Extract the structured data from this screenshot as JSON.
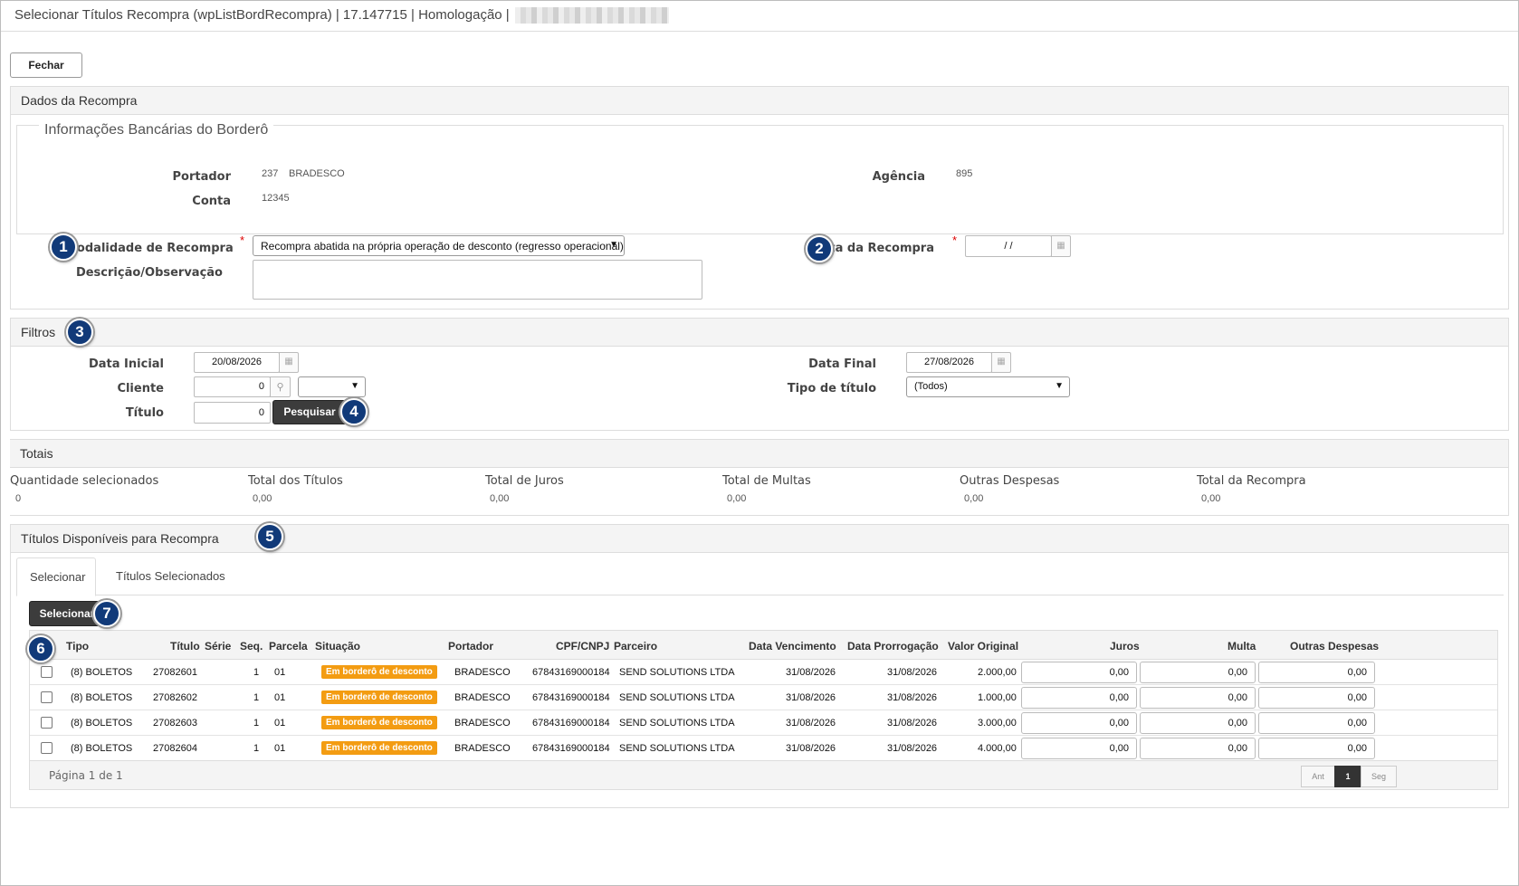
{
  "window": {
    "title": "Selecionar Títulos Recompra (wpListBordRecompra) | 17.147715 | Homologação |"
  },
  "toolbar": {
    "close_label": "Fechar"
  },
  "dados": {
    "header": "Dados da Recompra",
    "legend": "Informações Bancárias do Borderô",
    "portador_label": "Portador",
    "portador_code": "237",
    "portador_name": "BRADESCO",
    "agencia_label": "Agência",
    "agencia_value": "895",
    "conta_label": "Conta",
    "conta_value": "12345",
    "modalidade_label": "Modalidade de Recompra",
    "modalidade_value": "Recompra abatida na própria operação de desconto (regresso operacional)",
    "descricao_label": "Descrição/Observação",
    "descricao_value": "",
    "data_recompra_label": "Data da Recompra",
    "data_recompra_value": "/  /",
    "required_mark": "*"
  },
  "filtros": {
    "header": "Filtros",
    "data_inicial_label": "Data Inicial",
    "data_inicial_value": "20/08/2026",
    "data_final_label": "Data Final",
    "data_final_value": "27/08/2026",
    "cliente_label": "Cliente",
    "cliente_value": "0",
    "tipo_titulo_label": "Tipo de título",
    "tipo_titulo_value": "(Todos)",
    "titulo_label": "Título",
    "titulo_value": "0",
    "search_label": "Pesquisar"
  },
  "totais": {
    "header": "Totais",
    "items": [
      {
        "label": "Quantidade selecionados",
        "value": "0"
      },
      {
        "label": "Total dos Títulos",
        "value": "0,00"
      },
      {
        "label": "Total de Juros",
        "value": "0,00"
      },
      {
        "label": "Total de Multas",
        "value": "0,00"
      },
      {
        "label": "Outras Despesas",
        "value": "0,00"
      },
      {
        "label": "Total da Recompra",
        "value": "0,00"
      }
    ]
  },
  "titulos": {
    "header": "Títulos Disponíveis para Recompra",
    "tabs": [
      {
        "label": "Selecionar"
      },
      {
        "label": "Títulos Selecionados"
      }
    ],
    "select_label": "Selecionar",
    "columns": [
      "Tipo",
      "Título",
      "Série",
      "Seq.",
      "Parcela",
      "Situação",
      "Portador",
      "CPF/CNPJ",
      "Parceiro",
      "Data Vencimento",
      "Data Prorrogação",
      "Valor Original",
      "Juros",
      "Multa",
      "Outras Despesas"
    ],
    "rows": [
      {
        "tipo": "(8) BOLETOS",
        "titulo": "27082601",
        "serie": "",
        "seq": "1",
        "parcela": "01",
        "situacao": "Em borderô de desconto",
        "portador": "BRADESCO",
        "cnpj": "67843169000184",
        "parceiro": "SEND SOLUTIONS LTDA",
        "venc": "31/08/2026",
        "prorrog": "31/08/2026",
        "valor": "2.000,00",
        "juros": "0,00",
        "multa": "0,00",
        "outras": "0,00"
      },
      {
        "tipo": "(8) BOLETOS",
        "titulo": "27082602",
        "serie": "",
        "seq": "1",
        "parcela": "01",
        "situacao": "Em borderô de desconto",
        "portador": "BRADESCO",
        "cnpj": "67843169000184",
        "parceiro": "SEND SOLUTIONS LTDA",
        "venc": "31/08/2026",
        "prorrog": "31/08/2026",
        "valor": "1.000,00",
        "juros": "0,00",
        "multa": "0,00",
        "outras": "0,00"
      },
      {
        "tipo": "(8) BOLETOS",
        "titulo": "27082603",
        "serie": "",
        "seq": "1",
        "parcela": "01",
        "situacao": "Em borderô de desconto",
        "portador": "BRADESCO",
        "cnpj": "67843169000184",
        "parceiro": "SEND SOLUTIONS LTDA",
        "venc": "31/08/2026",
        "prorrog": "31/08/2026",
        "valor": "3.000,00",
        "juros": "0,00",
        "multa": "0,00",
        "outras": "0,00"
      },
      {
        "tipo": "(8) BOLETOS",
        "titulo": "27082604",
        "serie": "",
        "seq": "1",
        "parcela": "01",
        "situacao": "Em borderô de desconto",
        "portador": "BRADESCO",
        "cnpj": "67843169000184",
        "parceiro": "SEND SOLUTIONS LTDA",
        "venc": "31/08/2026",
        "prorrog": "31/08/2026",
        "valor": "4.000,00",
        "juros": "0,00",
        "multa": "0,00",
        "outras": "0,00"
      }
    ],
    "pagination": {
      "label": "Página 1 de 1",
      "prev": "Ant",
      "current": "1",
      "next": "Seg"
    }
  },
  "badges": [
    "1",
    "2",
    "3",
    "4",
    "5",
    "6",
    "7"
  ],
  "colors": {
    "badge": "#113a79",
    "situacao": "#f39c12",
    "dark_button": "#3c3c3c",
    "required": "#dd0000"
  }
}
